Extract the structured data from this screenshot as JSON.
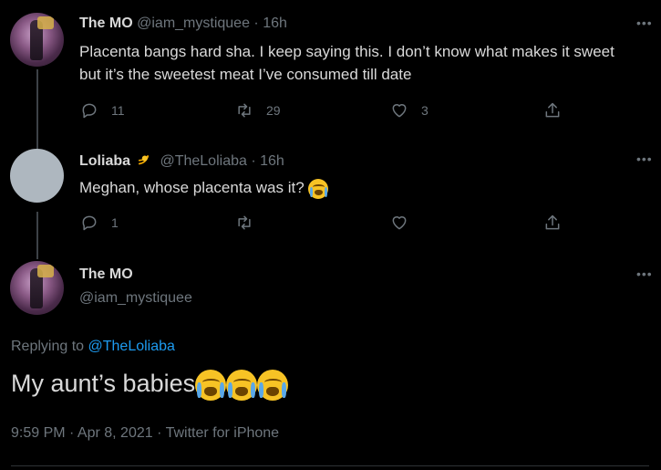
{
  "tweets": [
    {
      "name": "The MO",
      "handle": "@iam_mystiquee",
      "time": "· 16h",
      "text": "Placenta bangs hard sha. I keep saying this. I don’t know what makes it sweet but it’s the sweetest meat I’ve consumed till date",
      "replies": "11",
      "retweets": "29",
      "likes": "3"
    },
    {
      "name": "Loliaba",
      "handle": "@TheLoliaba",
      "time": "· 16h",
      "text": "Meghan, whose placenta was it?",
      "replies": "1",
      "retweets": "",
      "likes": ""
    }
  ],
  "main": {
    "name": "The MO",
    "handle": "@iam_mystiquee",
    "replying_prefix": "Replying to",
    "replying_to": "@TheLoliaba",
    "text": "My aunt’s babies",
    "meta": "9:59 PM · Apr 8, 2021 · Twitter for iPhone"
  },
  "more_label": "•••",
  "icons": {
    "reply": "reply-icon",
    "retweet": "retweet-icon",
    "like": "heart-icon",
    "share": "share-icon",
    "emoji": "loudly-crying-face-emoji"
  },
  "colors": {
    "background": "#000000",
    "text": "#d9d9d9",
    "muted": "#6e767d",
    "link": "#1d9bf0"
  }
}
